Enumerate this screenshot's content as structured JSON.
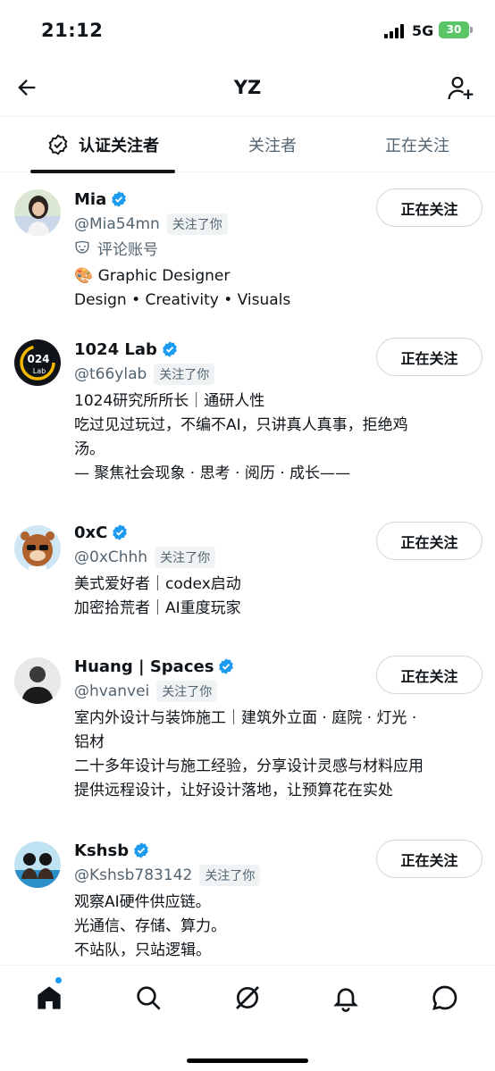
{
  "status": {
    "time": "21:12",
    "network": "5G",
    "battery": "30"
  },
  "nav": {
    "title": "YZ",
    "back_icon": "arrow-left-icon",
    "add_icon": "add-user-icon"
  },
  "tabs": [
    {
      "label": "认证关注者",
      "active": true
    },
    {
      "label": "关注者",
      "active": false
    },
    {
      "label": "正在关注",
      "active": false
    }
  ],
  "users": [
    {
      "name": "Mia",
      "handle": "@Mia54mn",
      "badge": "关注了你",
      "comment": "评论账号",
      "bio": [
        "🎨 Graphic Designer",
        "Design • Creativity • Visuals"
      ],
      "button": "正在关注"
    },
    {
      "name": "1024 Lab",
      "handle": "@t66ylab",
      "badge": "关注了你",
      "bio": [
        "1024研究所所长｜通研人性",
        "吃过见过玩过，不编不AI，只讲真人真事，拒绝鸡",
        "汤。",
        "— 聚焦社会现象 · 思考 · 阅历 · 成长——"
      ],
      "button": "正在关注"
    },
    {
      "name": "0xC",
      "handle": "@0xChhh",
      "badge": "关注了你",
      "bio": [
        "美式爱好者｜codex启动",
        "加密拾荒者｜AI重度玩家"
      ],
      "button": "正在关注"
    },
    {
      "name": "Huang | Spaces",
      "handle": "@hvanvei",
      "badge": "关注了你",
      "bio": [
        "室内外设计与装饰施工｜建筑外立面 · 庭院 · 灯光 ·",
        "铝材",
        "二十多年设计与施工经验，分享设计灵感与材料应用",
        "提供远程设计，让好设计落地，让预算花在实处"
      ],
      "button": "正在关注"
    },
    {
      "name": "Kshsb",
      "handle": "@Kshsb783142",
      "badge": "关注了你",
      "bio": [
        "观察AI硬件供应链。",
        "光通信、存储、算力。",
        "不站队，只站逻辑。"
      ],
      "button": "正在关注"
    }
  ],
  "bottom_nav": [
    "home-icon",
    "search-icon",
    "grok-icon",
    "notifications-icon",
    "messages-icon"
  ]
}
